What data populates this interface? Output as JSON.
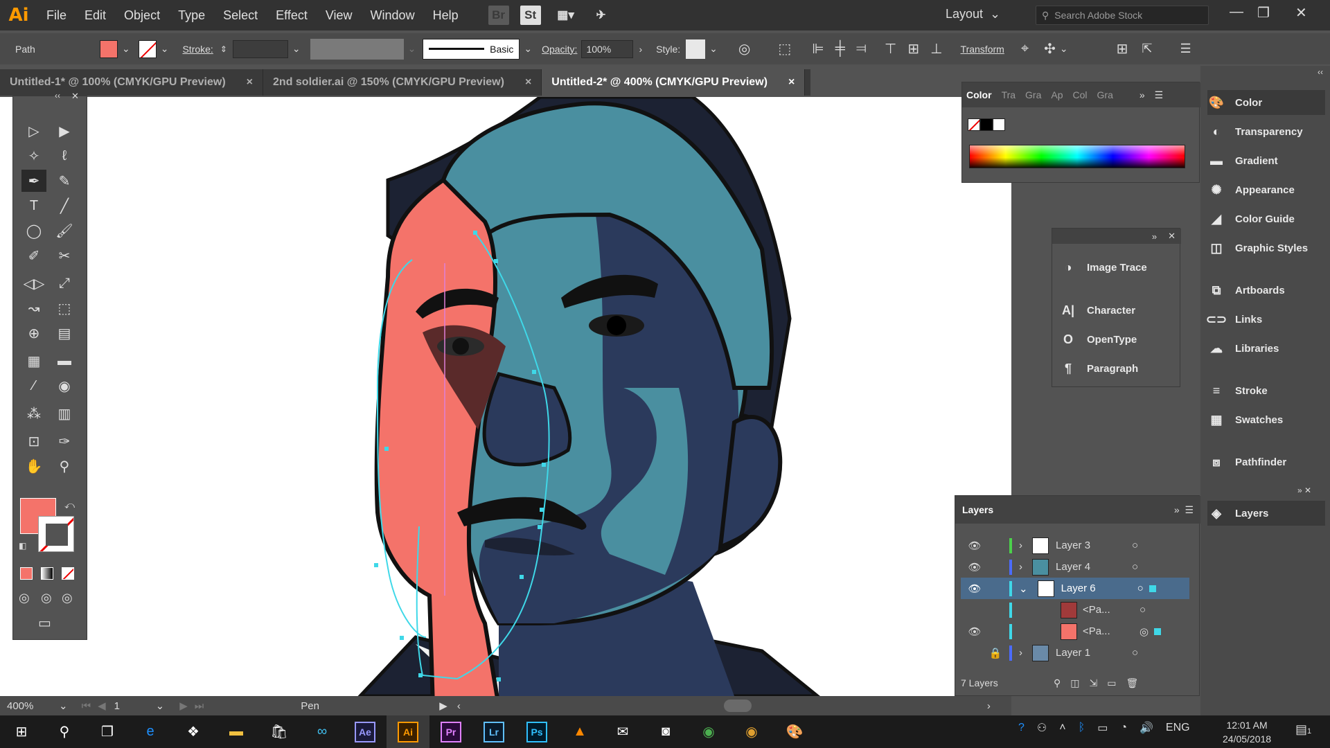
{
  "menubar": {
    "logo": "Ai",
    "items": [
      "File",
      "Edit",
      "Object",
      "Type",
      "Select",
      "Effect",
      "View",
      "Window",
      "Help"
    ],
    "bridge_label": "Br",
    "stock_label": "St",
    "workspace": "Layout",
    "search_placeholder": "Search Adobe Stock"
  },
  "control": {
    "selection_label": "Path",
    "stroke_label": "Stroke:",
    "brush_label": "Basic",
    "opacity_label": "Opacity:",
    "opacity_value": "100%",
    "style_label": "Style:",
    "transform_label": "Transform"
  },
  "tabs": [
    {
      "label": "Untitled-1* @ 100% (CMYK/GPU Preview)",
      "close": "×"
    },
    {
      "label": "2nd soldier.ai @ 150% (CMYK/GPU Preview)",
      "close": "×"
    },
    {
      "label": "Untitled-2* @ 400% (CMYK/GPU Preview)",
      "close": "×"
    }
  ],
  "status": {
    "zoom": "400%",
    "page": "1",
    "tool": "Pen"
  },
  "color_panel": {
    "title": "Color",
    "other_tabs": [
      "Tra",
      "Gra",
      "Ap",
      "Col",
      "Gra"
    ]
  },
  "mid_panel": {
    "items": [
      {
        "label": "Image Trace",
        "icon": "image-trace-icon"
      },
      {
        "label": "Character",
        "icon": "character-icon"
      },
      {
        "label": "OpenType",
        "icon": "opentype-icon"
      },
      {
        "label": "Paragraph",
        "icon": "paragraph-icon"
      }
    ]
  },
  "dock": {
    "items": [
      {
        "label": "Color",
        "icon": "color-icon"
      },
      {
        "label": "Transparency",
        "icon": "transparency-icon"
      },
      {
        "label": "Gradient",
        "icon": "gradient-icon"
      },
      {
        "label": "Appearance",
        "icon": "appearance-icon"
      },
      {
        "label": "Color Guide",
        "icon": "color-guide-icon"
      },
      {
        "label": "Graphic Styles",
        "icon": "graphic-styles-icon"
      },
      {
        "label": "Artboards",
        "icon": "artboards-icon"
      },
      {
        "label": "Links",
        "icon": "links-icon"
      },
      {
        "label": "Libraries",
        "icon": "libraries-icon"
      },
      {
        "label": "Stroke",
        "icon": "stroke-icon"
      },
      {
        "label": "Swatches",
        "icon": "swatches-icon"
      },
      {
        "label": "Pathfinder",
        "icon": "pathfinder-icon"
      },
      {
        "label": "Layers",
        "icon": "layers-icon"
      }
    ]
  },
  "layers": {
    "title": "Layers",
    "rows": [
      {
        "name": "Layer 3",
        "color": "#4bd04b"
      },
      {
        "name": "Layer 4",
        "color": "#4b6bff"
      },
      {
        "name": "Layer 6",
        "color": "#3fd8e8"
      },
      {
        "name": "<Pa...",
        "color": "#3fd8e8"
      },
      {
        "name": "<Pa...",
        "color": "#3fd8e8"
      },
      {
        "name": "Layer 1",
        "color": "#4b6bff"
      }
    ],
    "count": "7 Layers"
  },
  "taskbar": {
    "lang": "ENG",
    "time": "12:01 AM",
    "date": "24/05/2018",
    "notif": "1"
  },
  "colors": {
    "fill": "#f4736a",
    "accent": "#3fd8e8",
    "teal": "#4a8fa0",
    "navy": "#2b3a5c"
  }
}
